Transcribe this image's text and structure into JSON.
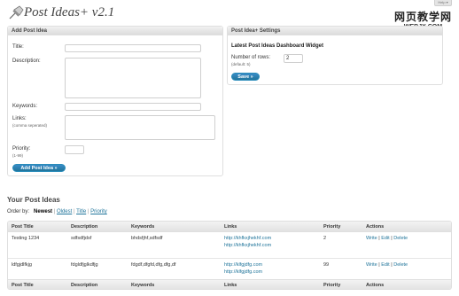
{
  "header": {
    "title": "Post Ideas+ v2.1",
    "help_label": "Help ▾"
  },
  "watermark": {
    "title": "网页教学网",
    "url": "WEBJX.COM"
  },
  "add_box": {
    "heading": "Add Post Idea",
    "title_label": "Title:",
    "description_label": "Description:",
    "keywords_label": "Keywords:",
    "links_label": "Links:",
    "links_hint": "(comma seperated)",
    "priority_label": "Priority:",
    "priority_hint": "(1-99)",
    "submit_label": "Add Post Idea »"
  },
  "settings_box": {
    "heading": "Post Idea+ Settings",
    "widget_title": "Latest Post Ideas Dashboard Widget",
    "rows_label": "Number of rows:",
    "rows_hint": "(default: 5)",
    "rows_value": "2",
    "save_label": "Save »"
  },
  "list": {
    "heading": "Your Post Ideas",
    "order_by_label": "Order by:",
    "order_current": "Newest",
    "order_options": [
      "Oldest",
      "Title",
      "Priority"
    ],
    "columns": [
      "Post Title",
      "Description",
      "Keywords",
      "Links",
      "Priority",
      "Actions"
    ],
    "rows": [
      {
        "title": "Testing 1234",
        "description": "sdfsdfjdsf",
        "keywords": "bhdsfjhf,sdfsdf",
        "links": [
          "http://khfkxjhekhf.com",
          "http://khfkxjhekhf.com"
        ],
        "priority": "2",
        "actions": [
          "Write",
          "Edit",
          "Delete"
        ]
      },
      {
        "title": "ldfgjdlfkjg",
        "description": "fdgldfjglkdfjg",
        "keywords": "fdgdf,dfgfd,dfg,dfg,df",
        "links": [
          "http://klfgjdfg.com",
          "http://klfgjdfg.com"
        ],
        "priority": "99",
        "actions": [
          "Write",
          "Edit",
          "Delete"
        ]
      }
    ]
  }
}
